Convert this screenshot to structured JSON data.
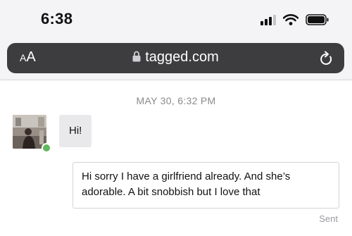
{
  "status_bar": {
    "time": "6:38",
    "icons": [
      "cellular-signal-icon",
      "wifi-icon",
      "battery-icon"
    ]
  },
  "browser": {
    "text_size_button": {
      "small": "A",
      "large": "A"
    },
    "url": "tagged.com",
    "icons": [
      "lock-icon",
      "reload-icon"
    ]
  },
  "chat": {
    "date_separator": "MAY 30, 6:32 PM",
    "contact": {
      "online": true,
      "avatar_icon": "profile-photo-icon"
    },
    "messages": [
      {
        "direction": "incoming",
        "text": "Hi!"
      },
      {
        "direction": "outgoing",
        "text": "Hi sorry I have a girlfriend already. And she’s adorable. A bit snobbish but I love that",
        "status": "Sent"
      }
    ]
  },
  "colors": {
    "online": "#5fb85a",
    "url_bar": "#3d3d3f",
    "incoming_bubble": "#e9e9eb"
  }
}
